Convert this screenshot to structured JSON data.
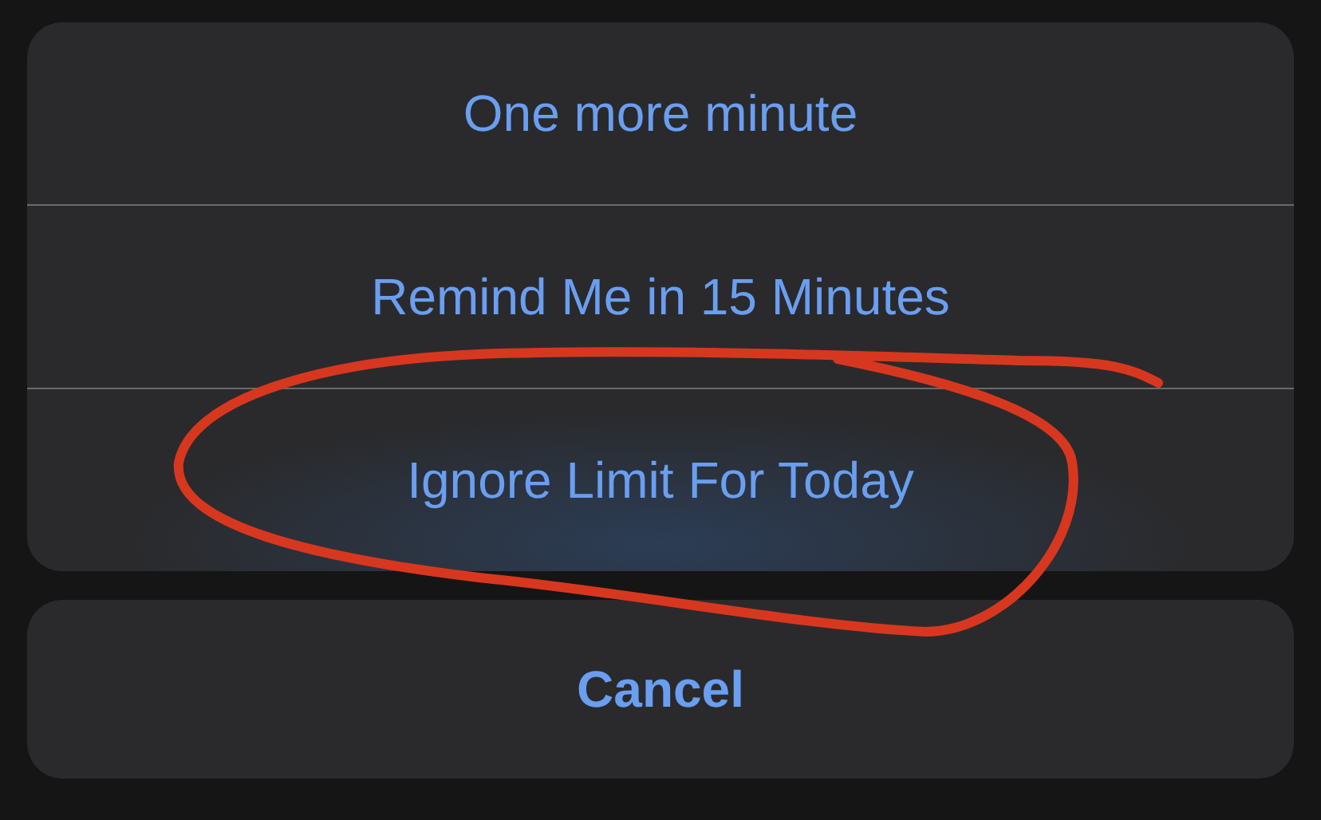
{
  "action_sheet": {
    "options": [
      {
        "label": "One more minute",
        "selected": false
      },
      {
        "label": "Remind Me in 15 Minutes",
        "selected": false
      },
      {
        "label": "Ignore Limit For Today",
        "selected": true
      }
    ],
    "cancel": {
      "label": "Cancel"
    }
  },
  "annotation": {
    "kind": "freehand-circle"
  }
}
